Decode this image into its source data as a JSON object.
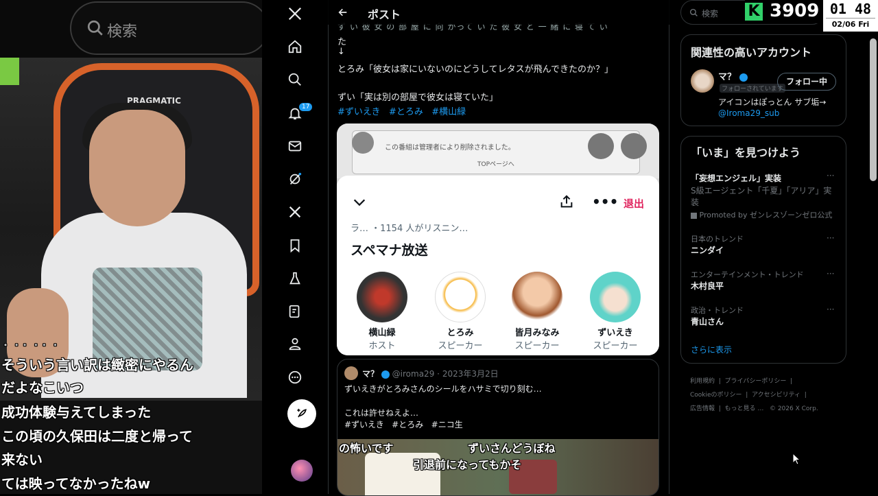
{
  "stream": {
    "search_placeholder": "検索",
    "chair_logo": "PRAGMATIC",
    "subtitles": [
      "そういう言い訳は緻密にやるん",
      "だよなこいつ",
      "成功体験与えてしまった",
      "この頃の久保田は二度と帰って",
      "来ない",
      "ては映ってなかったねw"
    ],
    "subtitle_faded": "・ ・・ ・・ ・"
  },
  "nav": {
    "notification_count": "17"
  },
  "header": {
    "title": "ポスト"
  },
  "post": {
    "lines": [
      "ず い 彼 女 の 部 屋 に 向 かって い た 彼 女 と 一 緒 に 寝 て い",
      "た",
      "↓",
      "とろみ「彼女は家にいないのにどうしてレタスが飛んできたのか？」",
      "",
      "ずい「実は別の部屋で彼女は寝ていた」"
    ],
    "hashtags": [
      "#ずいえき",
      "#とろみ",
      "#横山緑"
    ]
  },
  "space_card": {
    "bg_notice": "この番組は管理者により削除されました。",
    "bg_link": "TOPページへ",
    "exit_label": "退出",
    "listeners": "ラ… ・1154 人がリスニン…",
    "title": "スペマナ放送",
    "speakers": [
      {
        "name": "横山緑",
        "role": "ホスト",
        "color": "#c0392b"
      },
      {
        "name": "とろみ",
        "role": "スピーカー",
        "color": "#f2f2f2"
      },
      {
        "name": "皆月みなみ",
        "role": "スピーカー",
        "color": "#f3c9a8"
      },
      {
        "name": "ずいえき",
        "role": "スピーカー",
        "color": "#5fd3c9"
      }
    ]
  },
  "quote": {
    "name": "マ？",
    "handle": "@iroma29",
    "date": "2023年3月2日",
    "text1": "ずいえきがとろみさんのシールをハサミで切り刻む…",
    "text2": "これは許せねえよ…",
    "hashtags": [
      "#ずいえき",
      "#とろみ",
      "#ニコ生"
    ],
    "caption_left": "の怖いです",
    "caption_right": "ずいさんどうぼね",
    "caption_bottom": "引退前になってもかそ"
  },
  "right": {
    "search_placeholder": "検索",
    "k_value": "3909",
    "clock_time": "01 48",
    "clock_date": "02/06 Fri",
    "related_title": "関連性の高いアカウント",
    "account": {
      "name": "マ？",
      "follows_you": "フォローされています",
      "follow_button": "フォロー中",
      "bio": "アイコンはぽっとん サブ垢→",
      "bio_link": "@Iroma29_sub"
    },
    "trends_title": "「いま」を見つけよう",
    "trends": [
      {
        "context": "",
        "name": "「妄想エンジェル」実装",
        "extra": "S級エージェント「千夏」「アリア」実装",
        "promoted": "Promoted by ゼンレスゾーンゼロ公式"
      },
      {
        "context": "日本のトレンド",
        "name": "ニンダイ"
      },
      {
        "context": "エンターテインメント・トレンド",
        "name": "木村良平"
      },
      {
        "context": "政治・トレンド",
        "name": "青山さん"
      }
    ],
    "show_more": "さらに表示",
    "footer": {
      "line1": [
        "利用規約",
        "プライバシーポリシー"
      ],
      "line2": [
        "Cookieのポリシー",
        "アクセシビリティ"
      ],
      "line3": [
        "広告情報",
        "もっと見る …",
        "© 2026 X Corp."
      ]
    }
  }
}
